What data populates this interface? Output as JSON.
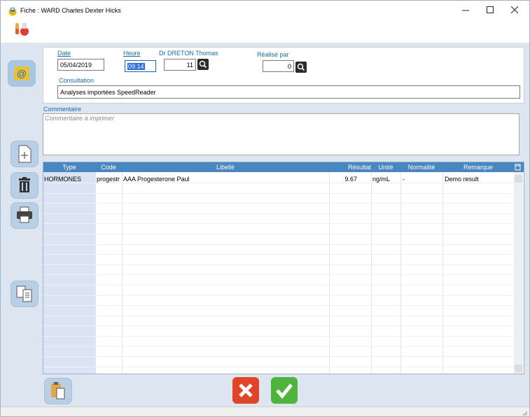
{
  "window": {
    "title": "Fiche : WARD Charles Dexter Hicks",
    "controls": [
      "minimize",
      "maximize",
      "close"
    ]
  },
  "form": {
    "date_label": "Date",
    "date_value": "05/04/2019",
    "heure_label": "Heure",
    "heure_value": "09:14",
    "doctor_label": "Dr DRETON Thomas",
    "doctor_value": "11",
    "realise_label": "Réalisé par",
    "realise_value": "0",
    "consultation_label": "Consultation",
    "consultation_value": "Analyses importées SpeedReader",
    "commentaire_label": "Commentaire",
    "commentaire_placeholder": "Commentaire à imprimer"
  },
  "grid": {
    "headers": [
      "Type",
      "Code",
      "Libellé",
      "Résultat",
      "Unité",
      "Normalité",
      "Remarque"
    ],
    "rows": [
      {
        "type": "HORMONES",
        "code": "progestr",
        "libelle": "AAA Progesterone Paul",
        "resultat": "9.67",
        "unite": "ng/mL",
        "normalite": "-",
        "remarque": "Demo result"
      }
    ]
  },
  "icons": {
    "app": "vial-icon",
    "toolbar": "test-tubes-icon",
    "side": [
      "at-icon",
      "new-document-icon",
      "trash-icon",
      "print-icon",
      "copy-documents-icon"
    ],
    "bottom": [
      "paste-icon",
      "cancel-icon",
      "confirm-icon"
    ]
  },
  "colors": {
    "accent": "#1b6ab0",
    "grid_header": "#4a86c0",
    "cancel": "#e0452a",
    "confirm": "#4fb33c",
    "rail": "#dde6f0"
  }
}
